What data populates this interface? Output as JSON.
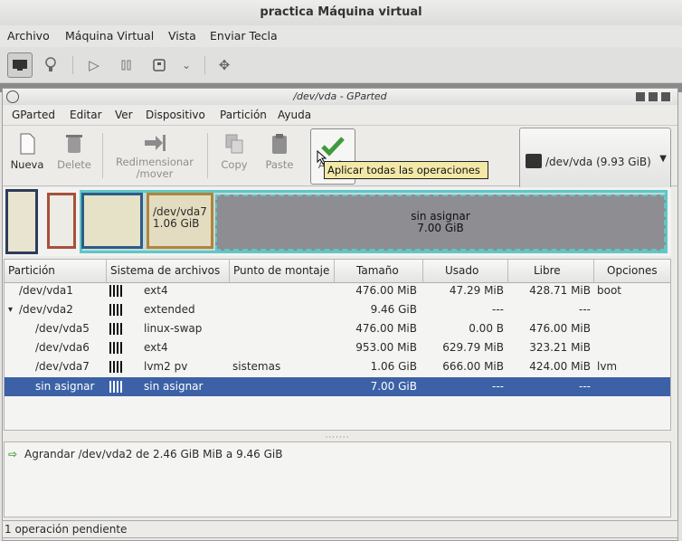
{
  "vm": {
    "title": "practica Máquina virtual",
    "menu": [
      "Archivo",
      "Máquina Virtual",
      "Vista",
      "Enviar Tecla"
    ]
  },
  "gparted": {
    "window_title": "/dev/vda - GParted",
    "menu": [
      "GParted",
      "Editar",
      "Ver",
      "Dispositivo",
      "Partición",
      "Ayuda"
    ],
    "toolbar": {
      "new": "Nueva",
      "delete": "Delete",
      "resize_line1": "Redimensionar",
      "resize_line2": "/mover",
      "copy": "Copy",
      "paste": "Paste",
      "apply": "Apply"
    },
    "tooltip": "Aplicar todas las operaciones",
    "device": "/dev/vda  (9.93 GiB)",
    "diskmap": {
      "vda7_name": "/dev/vda7",
      "vda7_size": "1.06 GiB",
      "unalloc_name": "sin asignar",
      "unalloc_size": "7.00 GiB"
    },
    "columns": [
      "Partición",
      "Sistema de archivos",
      "Punto de montaje",
      "Tamaño",
      "Usado",
      "Libre",
      "Opciones"
    ],
    "rows": [
      {
        "partition": "/dev/vda1",
        "fs": "ext4",
        "mount": "",
        "size": "476.00 MiB",
        "used": "47.29 MiB",
        "free": "428.71 MiB",
        "flags": "boot"
      },
      {
        "partition": "/dev/vda2",
        "fs": "extended",
        "mount": "",
        "size": "9.46 GiB",
        "used": "---",
        "free": "---",
        "flags": ""
      },
      {
        "partition": "/dev/vda5",
        "fs": "linux-swap",
        "mount": "",
        "size": "476.00 MiB",
        "used": "0.00 B",
        "free": "476.00 MiB",
        "flags": ""
      },
      {
        "partition": "/dev/vda6",
        "fs": "ext4",
        "mount": "",
        "size": "953.00 MiB",
        "used": "629.79 MiB",
        "free": "323.21 MiB",
        "flags": ""
      },
      {
        "partition": "/dev/vda7",
        "fs": "lvm2 pv",
        "mount": "sistemas",
        "size": "1.06 GiB",
        "used": "666.00 MiB",
        "free": "424.00 MiB",
        "flags": "lvm"
      },
      {
        "partition": "sin asignar",
        "fs": "sin asignar",
        "mount": "",
        "size": "7.00 GiB",
        "used": "---",
        "free": "---",
        "flags": ""
      }
    ],
    "operations": [
      "Agrandar /dev/vda2 de 2.46 GiB MiB a 9.46 GiB"
    ],
    "status": "1 operación pendiente",
    "colors": {
      "selection": "#3c61a6",
      "extended_border": "#5fc7c6",
      "unallocated": "#8d8d92",
      "tooltip_bg": "#f2e9a9",
      "apply_check": "#3f9a3c"
    }
  }
}
